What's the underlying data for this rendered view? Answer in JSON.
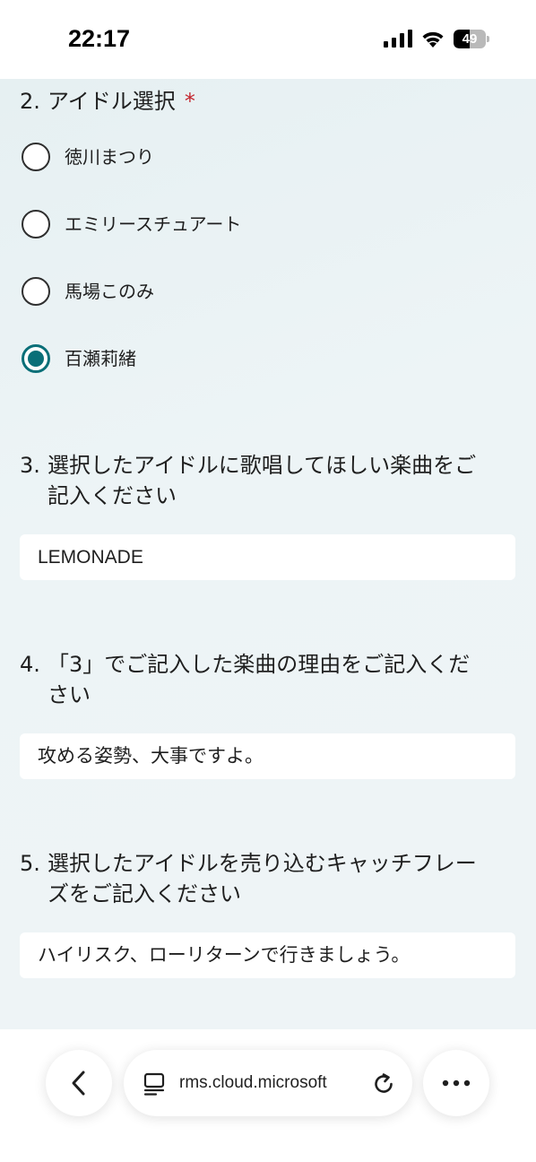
{
  "status_bar": {
    "time": "22:17",
    "battery": "49",
    "battery_level": 0.49
  },
  "form": {
    "q2": {
      "number": "2.",
      "title": "アイドル選択",
      "required_mark": "*",
      "options": [
        {
          "label": "徳川まつり",
          "selected": false
        },
        {
          "label": "エミリースチュアート",
          "selected": false
        },
        {
          "label": "馬場このみ",
          "selected": false
        },
        {
          "label": "百瀬莉緒",
          "selected": true
        }
      ]
    },
    "q3": {
      "number": "3.",
      "title_line1": "選択したアイドルに歌唱してほしい楽曲をご",
      "title_line2": "記入ください",
      "answer": "LEMONADE"
    },
    "q4": {
      "number": "4.",
      "title_line1": "「3」でご記入した楽曲の理由をご記入くだ",
      "title_line2": "さい",
      "answer": "攻める姿勢、大事ですよ。"
    },
    "q5": {
      "number": "5.",
      "title_line1": "選択したアイドルを売り込むキャッチフレー",
      "title_line2": "ズをご記入ください",
      "answer": "ハイリスク、ローリターンで行きましょう。"
    }
  },
  "browser": {
    "url": "rms.cloud.microsoft",
    "icons": [
      "back-icon",
      "tab-icon",
      "reload-icon",
      "more-icon"
    ]
  },
  "colors": {
    "accent": "#0a6f78",
    "required": "#c4262e",
    "form_background": "#eaf2f4"
  }
}
